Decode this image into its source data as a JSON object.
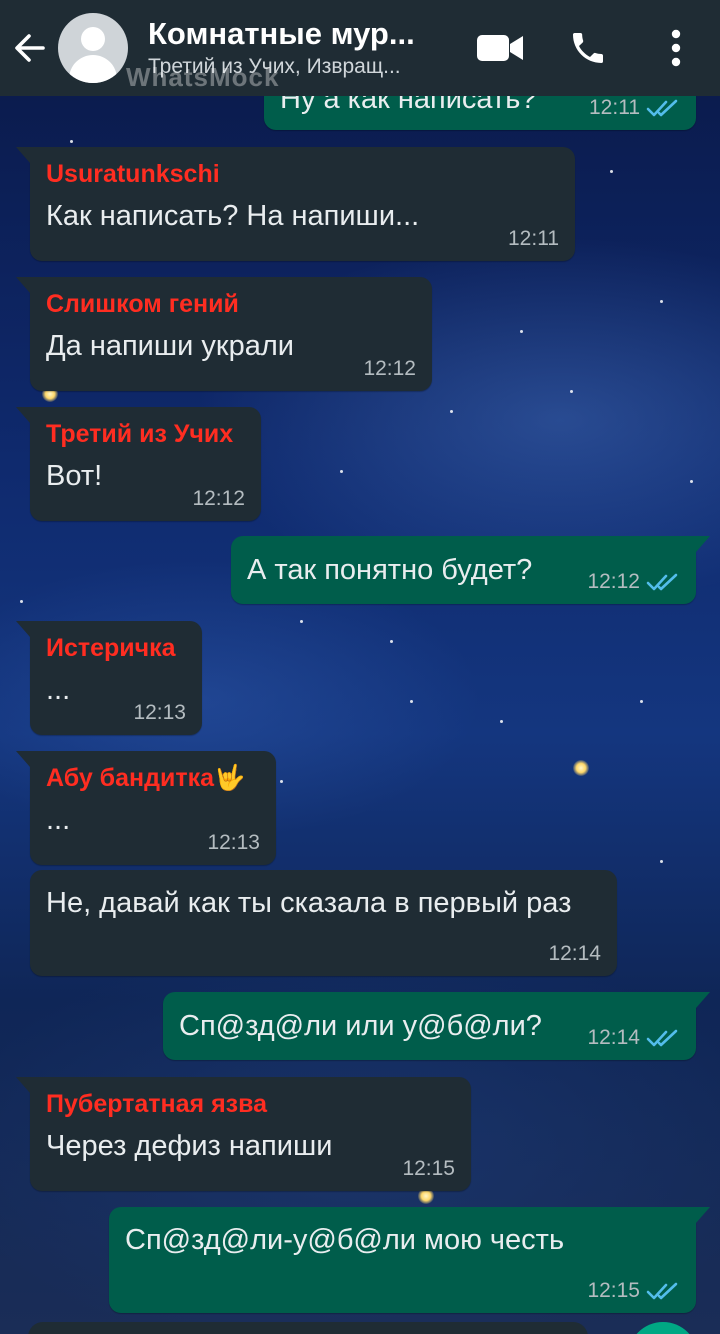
{
  "header": {
    "title": "Комнатные мур...",
    "subtitle": "Третий из Учих, Извращ...",
    "watermark": "WhatsMock",
    "icons": [
      "back-arrow-icon",
      "video-call-icon",
      "phone-icon",
      "more-options-icon"
    ]
  },
  "messages": [
    {
      "direction": "out",
      "text": "Ну а как написать?",
      "time": "12:11",
      "read": true
    },
    {
      "direction": "in",
      "sender": "Usuratunkschi",
      "text": "Как написать? На напиши...",
      "time": "12:11"
    },
    {
      "direction": "in",
      "sender": "Слишком гений",
      "text": "Да напиши украли",
      "time": "12:12"
    },
    {
      "direction": "in",
      "sender": "Третий из Учих",
      "text": "Вот!",
      "time": "12:12"
    },
    {
      "direction": "out",
      "text": "А так понятно будет?",
      "time": "12:12",
      "read": true
    },
    {
      "direction": "in",
      "sender": "Истеричка",
      "text": "...",
      "time": "12:13"
    },
    {
      "direction": "in",
      "sender": "Абу бандитка🤟",
      "text": "...",
      "time": "12:13"
    },
    {
      "direction": "in",
      "text": "Не, давай как ты сказала в первый раз",
      "time": "12:14"
    },
    {
      "direction": "out",
      "text": "Сп@зд@ли или у@б@ли?",
      "time": "12:14",
      "read": true
    },
    {
      "direction": "in",
      "sender": "Пубертатная язва",
      "text": "Через дефиз напиши",
      "time": "12:15"
    },
    {
      "direction": "out",
      "text": "Сп@зд@ли-у@б@ли мою честь",
      "time": "12:15",
      "read": true
    }
  ],
  "colors": {
    "header_bg": "#1f2c34",
    "incoming_bubble": "#1f2c34",
    "outgoing_bubble": "#005d4b",
    "sender_name": "#ff2d21",
    "read_ticks": "#53bdeb"
  }
}
